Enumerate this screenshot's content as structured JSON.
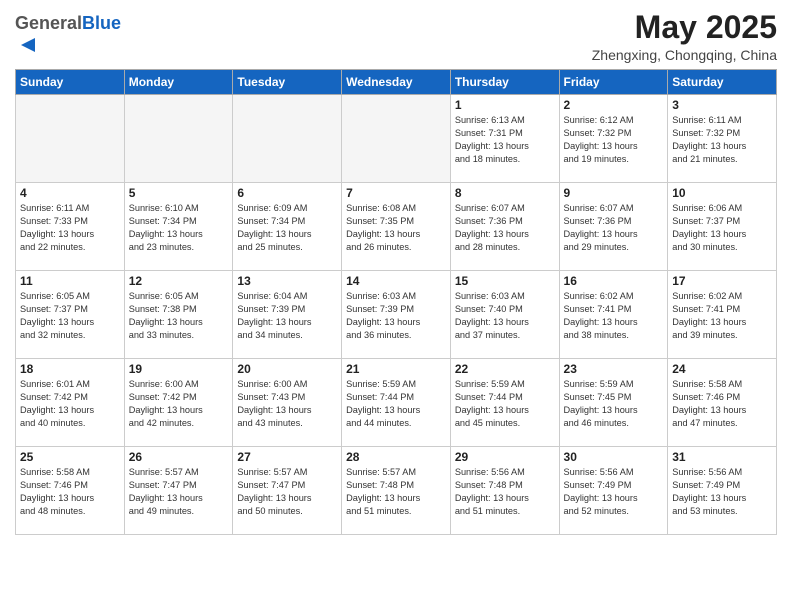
{
  "logo": {
    "general": "General",
    "blue": "Blue"
  },
  "header": {
    "month_title": "May 2025",
    "subtitle": "Zhengxing, Chongqing, China"
  },
  "weekdays": [
    "Sunday",
    "Monday",
    "Tuesday",
    "Wednesday",
    "Thursday",
    "Friday",
    "Saturday"
  ],
  "weeks": [
    [
      {
        "day": "",
        "info": ""
      },
      {
        "day": "",
        "info": ""
      },
      {
        "day": "",
        "info": ""
      },
      {
        "day": "",
        "info": ""
      },
      {
        "day": "1",
        "info": "Sunrise: 6:13 AM\nSunset: 7:31 PM\nDaylight: 13 hours\nand 18 minutes."
      },
      {
        "day": "2",
        "info": "Sunrise: 6:12 AM\nSunset: 7:32 PM\nDaylight: 13 hours\nand 19 minutes."
      },
      {
        "day": "3",
        "info": "Sunrise: 6:11 AM\nSunset: 7:32 PM\nDaylight: 13 hours\nand 21 minutes."
      }
    ],
    [
      {
        "day": "4",
        "info": "Sunrise: 6:11 AM\nSunset: 7:33 PM\nDaylight: 13 hours\nand 22 minutes."
      },
      {
        "day": "5",
        "info": "Sunrise: 6:10 AM\nSunset: 7:34 PM\nDaylight: 13 hours\nand 23 minutes."
      },
      {
        "day": "6",
        "info": "Sunrise: 6:09 AM\nSunset: 7:34 PM\nDaylight: 13 hours\nand 25 minutes."
      },
      {
        "day": "7",
        "info": "Sunrise: 6:08 AM\nSunset: 7:35 PM\nDaylight: 13 hours\nand 26 minutes."
      },
      {
        "day": "8",
        "info": "Sunrise: 6:07 AM\nSunset: 7:36 PM\nDaylight: 13 hours\nand 28 minutes."
      },
      {
        "day": "9",
        "info": "Sunrise: 6:07 AM\nSunset: 7:36 PM\nDaylight: 13 hours\nand 29 minutes."
      },
      {
        "day": "10",
        "info": "Sunrise: 6:06 AM\nSunset: 7:37 PM\nDaylight: 13 hours\nand 30 minutes."
      }
    ],
    [
      {
        "day": "11",
        "info": "Sunrise: 6:05 AM\nSunset: 7:37 PM\nDaylight: 13 hours\nand 32 minutes."
      },
      {
        "day": "12",
        "info": "Sunrise: 6:05 AM\nSunset: 7:38 PM\nDaylight: 13 hours\nand 33 minutes."
      },
      {
        "day": "13",
        "info": "Sunrise: 6:04 AM\nSunset: 7:39 PM\nDaylight: 13 hours\nand 34 minutes."
      },
      {
        "day": "14",
        "info": "Sunrise: 6:03 AM\nSunset: 7:39 PM\nDaylight: 13 hours\nand 36 minutes."
      },
      {
        "day": "15",
        "info": "Sunrise: 6:03 AM\nSunset: 7:40 PM\nDaylight: 13 hours\nand 37 minutes."
      },
      {
        "day": "16",
        "info": "Sunrise: 6:02 AM\nSunset: 7:41 PM\nDaylight: 13 hours\nand 38 minutes."
      },
      {
        "day": "17",
        "info": "Sunrise: 6:02 AM\nSunset: 7:41 PM\nDaylight: 13 hours\nand 39 minutes."
      }
    ],
    [
      {
        "day": "18",
        "info": "Sunrise: 6:01 AM\nSunset: 7:42 PM\nDaylight: 13 hours\nand 40 minutes."
      },
      {
        "day": "19",
        "info": "Sunrise: 6:00 AM\nSunset: 7:42 PM\nDaylight: 13 hours\nand 42 minutes."
      },
      {
        "day": "20",
        "info": "Sunrise: 6:00 AM\nSunset: 7:43 PM\nDaylight: 13 hours\nand 43 minutes."
      },
      {
        "day": "21",
        "info": "Sunrise: 5:59 AM\nSunset: 7:44 PM\nDaylight: 13 hours\nand 44 minutes."
      },
      {
        "day": "22",
        "info": "Sunrise: 5:59 AM\nSunset: 7:44 PM\nDaylight: 13 hours\nand 45 minutes."
      },
      {
        "day": "23",
        "info": "Sunrise: 5:59 AM\nSunset: 7:45 PM\nDaylight: 13 hours\nand 46 minutes."
      },
      {
        "day": "24",
        "info": "Sunrise: 5:58 AM\nSunset: 7:46 PM\nDaylight: 13 hours\nand 47 minutes."
      }
    ],
    [
      {
        "day": "25",
        "info": "Sunrise: 5:58 AM\nSunset: 7:46 PM\nDaylight: 13 hours\nand 48 minutes."
      },
      {
        "day": "26",
        "info": "Sunrise: 5:57 AM\nSunset: 7:47 PM\nDaylight: 13 hours\nand 49 minutes."
      },
      {
        "day": "27",
        "info": "Sunrise: 5:57 AM\nSunset: 7:47 PM\nDaylight: 13 hours\nand 50 minutes."
      },
      {
        "day": "28",
        "info": "Sunrise: 5:57 AM\nSunset: 7:48 PM\nDaylight: 13 hours\nand 51 minutes."
      },
      {
        "day": "29",
        "info": "Sunrise: 5:56 AM\nSunset: 7:48 PM\nDaylight: 13 hours\nand 51 minutes."
      },
      {
        "day": "30",
        "info": "Sunrise: 5:56 AM\nSunset: 7:49 PM\nDaylight: 13 hours\nand 52 minutes."
      },
      {
        "day": "31",
        "info": "Sunrise: 5:56 AM\nSunset: 7:49 PM\nDaylight: 13 hours\nand 53 minutes."
      }
    ]
  ]
}
